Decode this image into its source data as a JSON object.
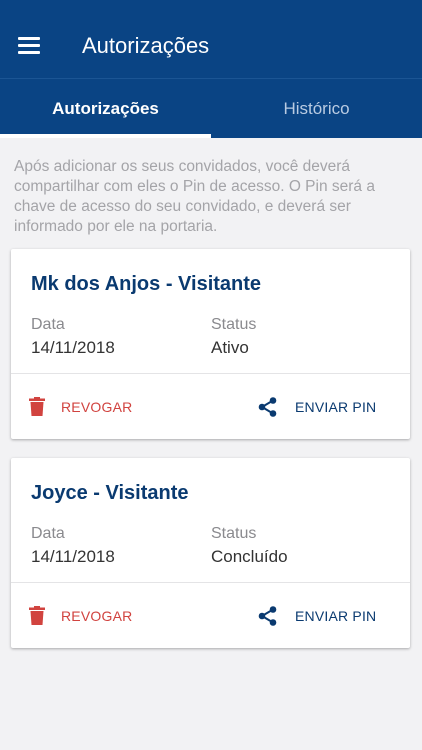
{
  "appbar": {
    "title": "Autorizações",
    "menu_icon": "hamburger-menu-icon"
  },
  "tabs": [
    {
      "label": "Autorizações",
      "active": true
    },
    {
      "label": "Histórico",
      "active": false
    }
  ],
  "intro_text": "Após adicionar os seus convidados, você deverá compartilhar com eles o Pin de acesso. O Pin será a chave de acesso do seu convidado, e deverá ser informado por ele na portaria.",
  "cards": [
    {
      "title": "Mk dos Anjos - Visitante",
      "date_label": "Data",
      "date_value": "14/11/2018",
      "status_label": "Status",
      "status_value": "Ativo",
      "revoke_label": "REVOGAR",
      "send_label": "ENVIAR PIN"
    },
    {
      "title": "Joyce - Visitante",
      "date_label": "Data",
      "date_value": "14/11/2018",
      "status_label": "Status",
      "status_value": "Concluído",
      "revoke_label": "REVOGAR",
      "send_label": "ENVIAR PIN"
    }
  ],
  "colors": {
    "primary": "#0a4484",
    "title_text": "#0a3a70",
    "danger": "#d1433f",
    "muted_text": "#a4a4a8"
  }
}
